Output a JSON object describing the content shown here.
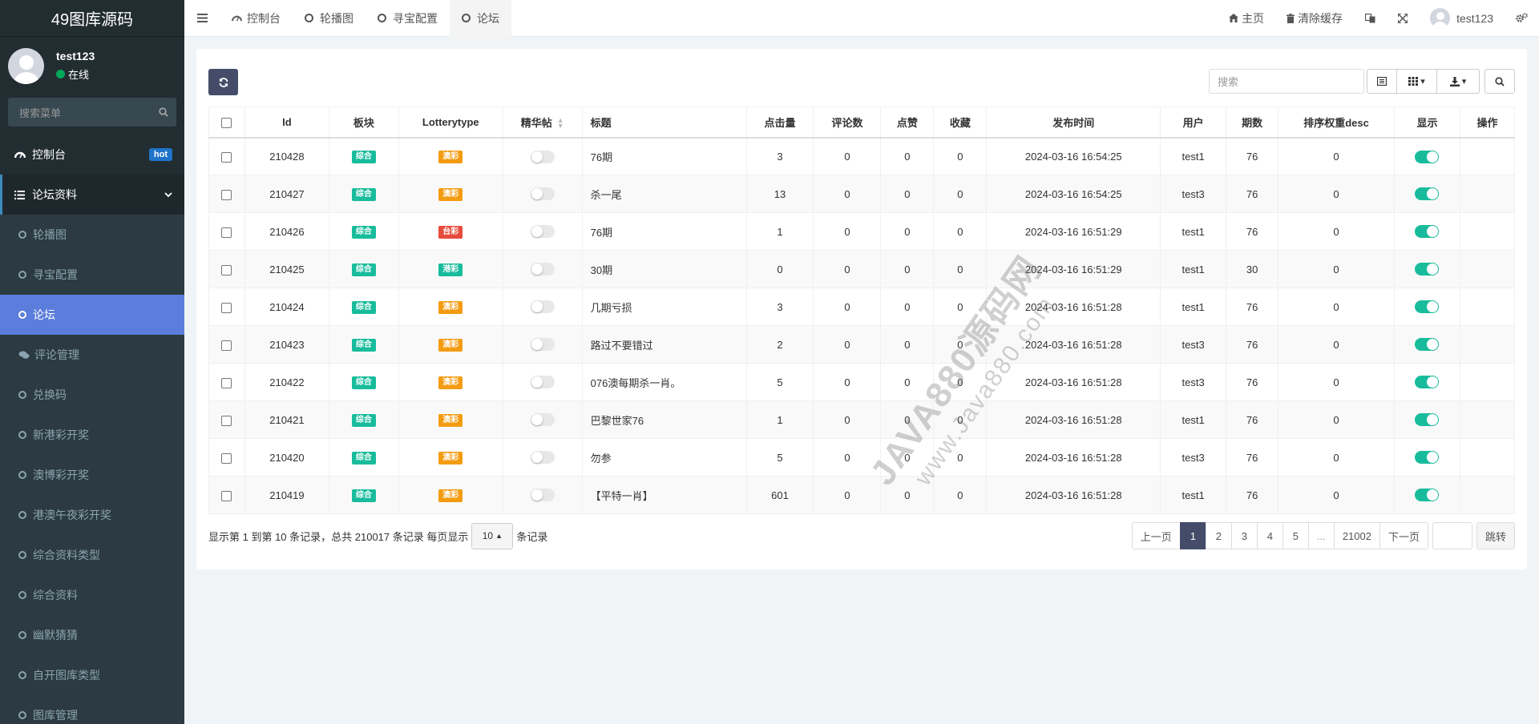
{
  "app": {
    "title": "49图库源码"
  },
  "user": {
    "name": "test123",
    "status": "在线"
  },
  "sidebar": {
    "search_placeholder": "搜索菜单",
    "dashboard": {
      "label": "控制台",
      "badge": "hot"
    },
    "group": {
      "label": "论坛资料"
    },
    "items": [
      {
        "label": "轮播图"
      },
      {
        "label": "寻宝配置"
      },
      {
        "label": "论坛"
      },
      {
        "label": "评论管理"
      },
      {
        "label": "兑换码"
      },
      {
        "label": "新港彩开奖"
      },
      {
        "label": "澳博彩开奖"
      },
      {
        "label": "港澳午夜彩开奖"
      },
      {
        "label": "综合资料类型"
      },
      {
        "label": "综合资料"
      },
      {
        "label": "幽默猜猜"
      },
      {
        "label": "自开图库类型"
      },
      {
        "label": "图库管理"
      }
    ]
  },
  "header": {
    "tabs": [
      {
        "label": "控制台"
      },
      {
        "label": "轮播图"
      },
      {
        "label": "寻宝配置"
      },
      {
        "label": "论坛"
      }
    ],
    "home": "主页",
    "clear_cache": "清除缓存",
    "username": "test123"
  },
  "toolbar": {
    "search_placeholder": "搜索"
  },
  "table": {
    "headers": [
      "Id",
      "板块",
      "Lotterytype",
      "精华帖",
      "标题",
      "点击量",
      "评论数",
      "点赞",
      "收藏",
      "发布时间",
      "用户",
      "期数",
      "排序权重desc",
      "显示",
      "操作"
    ],
    "rows": [
      {
        "id": "210428",
        "block": "综合",
        "lottery": "澳彩",
        "lottery_color": "#f39c12",
        "title": "76期",
        "clicks": "3",
        "comments": "0",
        "likes": "0",
        "favs": "0",
        "time": "2024-03-16 16:54:25",
        "user": "test1",
        "issue": "76",
        "weight": "0"
      },
      {
        "id": "210427",
        "block": "综合",
        "lottery": "澳彩",
        "lottery_color": "#f39c12",
        "title": "杀一尾",
        "clicks": "13",
        "comments": "0",
        "likes": "0",
        "favs": "0",
        "time": "2024-03-16 16:54:25",
        "user": "test3",
        "issue": "76",
        "weight": "0"
      },
      {
        "id": "210426",
        "block": "综合",
        "lottery": "台彩",
        "lottery_color": "#e74c3c",
        "title": "76期",
        "clicks": "1",
        "comments": "0",
        "likes": "0",
        "favs": "0",
        "time": "2024-03-16 16:51:29",
        "user": "test1",
        "issue": "76",
        "weight": "0"
      },
      {
        "id": "210425",
        "block": "综合",
        "lottery": "港彩",
        "lottery_color": "#18bc9c",
        "title": "30期",
        "clicks": "0",
        "comments": "0",
        "likes": "0",
        "favs": "0",
        "time": "2024-03-16 16:51:29",
        "user": "test1",
        "issue": "30",
        "weight": "0"
      },
      {
        "id": "210424",
        "block": "综合",
        "lottery": "澳彩",
        "lottery_color": "#f39c12",
        "title": "几期亏损",
        "clicks": "3",
        "comments": "0",
        "likes": "0",
        "favs": "0",
        "time": "2024-03-16 16:51:28",
        "user": "test1",
        "issue": "76",
        "weight": "0"
      },
      {
        "id": "210423",
        "block": "综合",
        "lottery": "澳彩",
        "lottery_color": "#f39c12",
        "title": "路过不要错过",
        "clicks": "2",
        "comments": "0",
        "likes": "0",
        "favs": "0",
        "time": "2024-03-16 16:51:28",
        "user": "test3",
        "issue": "76",
        "weight": "0"
      },
      {
        "id": "210422",
        "block": "综合",
        "lottery": "澳彩",
        "lottery_color": "#f39c12",
        "title": "076澳每期杀一肖。",
        "clicks": "5",
        "comments": "0",
        "likes": "0",
        "favs": "0",
        "time": "2024-03-16 16:51:28",
        "user": "test3",
        "issue": "76",
        "weight": "0"
      },
      {
        "id": "210421",
        "block": "综合",
        "lottery": "澳彩",
        "lottery_color": "#f39c12",
        "title": "巴黎世家76",
        "clicks": "1",
        "comments": "0",
        "likes": "0",
        "favs": "0",
        "time": "2024-03-16 16:51:28",
        "user": "test1",
        "issue": "76",
        "weight": "0"
      },
      {
        "id": "210420",
        "block": "综合",
        "lottery": "澳彩",
        "lottery_color": "#f39c12",
        "title": "勿参",
        "clicks": "5",
        "comments": "0",
        "likes": "0",
        "favs": "0",
        "time": "2024-03-16 16:51:28",
        "user": "test3",
        "issue": "76",
        "weight": "0"
      },
      {
        "id": "210419",
        "block": "综合",
        "lottery": "澳彩",
        "lottery_color": "#f39c12",
        "title": "【平特一肖】",
        "clicks": "601",
        "comments": "0",
        "likes": "0",
        "favs": "0",
        "time": "2024-03-16 16:51:28",
        "user": "test1",
        "issue": "76",
        "weight": "0"
      }
    ]
  },
  "pagination": {
    "info_prefix": "显示第 1 到第 10 条记录，总共 210017 条记录 每页显示",
    "page_size": "10",
    "info_suffix": "条记录",
    "prev": "上一页",
    "pages": [
      "1",
      "2",
      "3",
      "4",
      "5",
      "...",
      "21002"
    ],
    "next": "下一页",
    "jump": "跳转"
  },
  "watermark": {
    "line1": "JAVA880源码网",
    "line2": "www.Java880.com"
  },
  "colors": {
    "sidebar_bg": "#222d32",
    "active_menu": "#5b7ddb",
    "primary_dark": "#444c69",
    "switch_on": "#18bc9c",
    "block_label": "#18bc9c"
  }
}
